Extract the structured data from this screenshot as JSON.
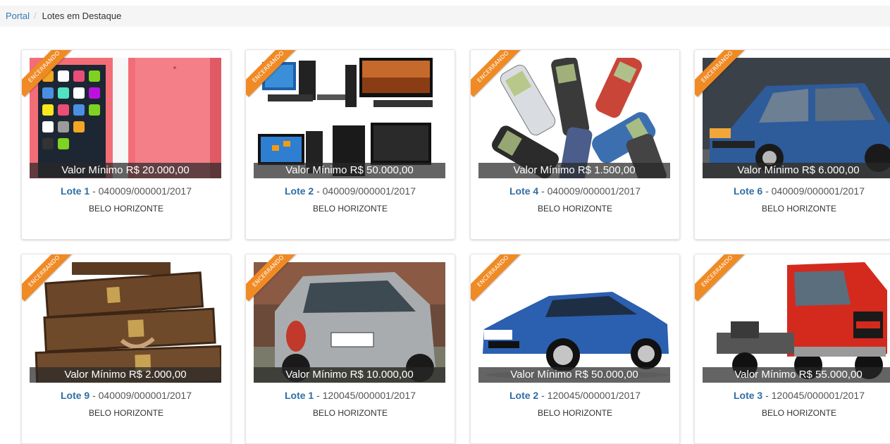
{
  "breadcrumb": {
    "portal": "Portal",
    "separator": "/",
    "current": "Lotes em Destaque"
  },
  "lots": [
    {
      "ribbon": "ENCERRANDO",
      "price": "Valor Mínimo R$ 20.000,00",
      "lote_label": "Lote 1",
      "process": " - 040009/000001/2017",
      "city": "BELO HORIZONTE",
      "image": "pink-phone"
    },
    {
      "ribbon": "ENCERRANDO",
      "price": "Valor Mínimo R$ 50.000,00",
      "lote_label": "Lote 2",
      "process": " - 040009/000001/2017",
      "city": "BELO HORIZONTE",
      "image": "computers"
    },
    {
      "ribbon": "ENCERRANDO",
      "price": "Valor Mínimo R$ 1.500,00",
      "lote_label": "Lote 4",
      "process": " - 040009/000001/2017",
      "city": "BELO HORIZONTE",
      "image": "old-phones"
    },
    {
      "ribbon": "ENCERRANDO",
      "price": "Valor Mínimo R$ 6.000,00",
      "lote_label": "Lote 6",
      "process": " - 040009/000001/2017",
      "city": "BELO HORIZONTE",
      "image": "blue-car"
    },
    {
      "ribbon": "ENCERRANDO",
      "price": "Valor Mínimo R$ 2.000,00",
      "lote_label": "Lote 9",
      "process": " - 040009/000001/2017",
      "city": "BELO HORIZONTE",
      "image": "suitcases"
    },
    {
      "ribbon": "ENCERRANDO",
      "price": "Valor Mínimo R$ 10.000,00",
      "lote_label": "Lote 1",
      "process": " - 120045/000001/2017",
      "city": "BELO HORIZONTE",
      "image": "silver-car"
    },
    {
      "ribbon": "ENCERRANDO",
      "price": "Valor Mínimo R$ 50.000,00",
      "lote_label": "Lote 2",
      "process": " - 120045/000001/2017",
      "city": "BELO HORIZONTE",
      "image": "bmw"
    },
    {
      "ribbon": "ENCERRANDO",
      "price": "Valor Mínimo R$ 55.000,00",
      "lote_label": "Lote 3",
      "process": " - 120045/000001/2017",
      "city": "BELO HORIZONTE",
      "image": "truck"
    }
  ],
  "colors": {
    "link": "#2e6da4",
    "ribbon": "#f08a24"
  }
}
